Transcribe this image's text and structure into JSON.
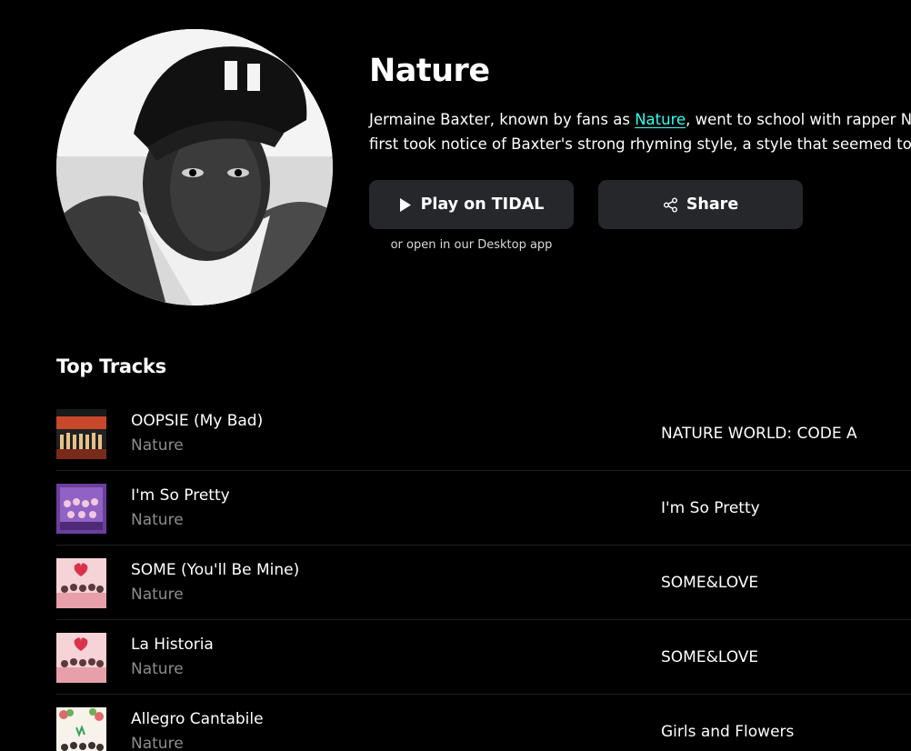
{
  "artist": {
    "name": "Nature",
    "bio": {
      "line1_before": "Jermaine Baxter, known by fans as ",
      "line1_link": "Nature",
      "line1_after": ", went to school with rapper Na",
      "line2": "first took notice of Baxter's strong rhyming style, a style that seemed to c"
    }
  },
  "actions": {
    "play_label": "Play on TIDAL",
    "share_label": "Share",
    "desktop_note": "or open in our Desktop app"
  },
  "top_tracks": {
    "title": "Top Tracks",
    "items": [
      {
        "title": "OOPSIE (My Bad)",
        "artist": "Nature",
        "album": "NATURE WORLD: CODE A"
      },
      {
        "title": "I'm So Pretty",
        "artist": "Nature",
        "album": "I'm So Pretty"
      },
      {
        "title": "SOME (You'll Be Mine)",
        "artist": "Nature",
        "album": "SOME&LOVE"
      },
      {
        "title": "La Historia",
        "artist": "Nature",
        "album": "SOME&LOVE"
      },
      {
        "title": "Allegro Cantabile",
        "artist": "Nature",
        "album": "Girls and Flowers"
      }
    ]
  },
  "icons": {
    "play": "play-icon",
    "share": "share-icon"
  },
  "colors": {
    "background": "#000000",
    "button": "#26272b",
    "link": "#33ffee",
    "muted_text": "#8c8c8c"
  }
}
